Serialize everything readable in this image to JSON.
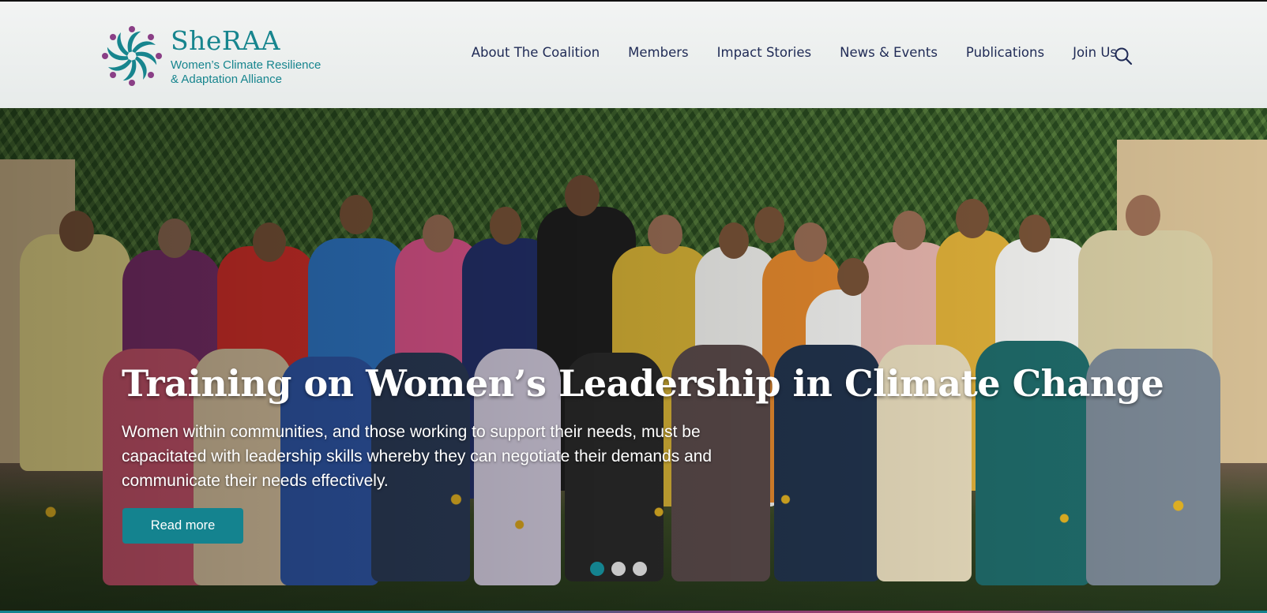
{
  "brand": {
    "name": "SheRAA",
    "tagline_line1": "Women’s Climate Resilience",
    "tagline_line2": "& Adaptation Alliance",
    "color_teal": "#17858e",
    "color_purple": "#8a3f86"
  },
  "nav": {
    "items": [
      {
        "label": "About The Coalition"
      },
      {
        "label": "Members"
      },
      {
        "label": "Impact Stories"
      },
      {
        "label": "News & Events"
      },
      {
        "label": "Publications"
      },
      {
        "label": "Join Us"
      }
    ],
    "search_icon": "search-icon",
    "text_color": "#1f2a55"
  },
  "hero": {
    "title": "Training on Women’s Leadership in Climate Change",
    "description": "Women within communities, and those working to support their needs, must be capacitated with leadership skills whereby they can negotiate their demands and communicate their needs effectively.",
    "button_label": "Read more",
    "button_color": "#14838f",
    "slides_total": 3,
    "active_slide": 1
  }
}
